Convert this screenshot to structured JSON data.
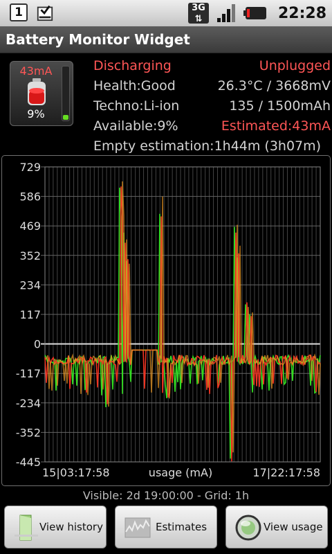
{
  "status_bar": {
    "notification_count": "1",
    "network_type": "3G",
    "time": "22:28"
  },
  "app": {
    "title": "Battery Monitor Widget"
  },
  "widget": {
    "current": "43mA",
    "percent": "9%",
    "level": 0.09
  },
  "info": {
    "state": "Discharging",
    "plug": "Unplugged",
    "health": "Health:Good",
    "temp_voltage": "26.3°C / 3668mV",
    "techno": "Techno:Li-ion",
    "capacity": "135 / 1500mAh",
    "available": "Available:9%",
    "estimated": "Estimated:43mA",
    "empty_estimation": "Empty estimation:1h44m (3h07m)"
  },
  "graph": {
    "y_ticks": [
      "729",
      "586",
      "469",
      "352",
      "234",
      "117",
      "0",
      "-117",
      "-234",
      "-352",
      "-445"
    ],
    "x_start_label": "15|03:17:58",
    "x_title": "usage (mA)",
    "x_end_label": "17|22:17:58",
    "colors": {
      "series_a": "#33dd22",
      "series_b": "#ee3322",
      "series_c": "#ee9922",
      "grid": "#444444",
      "zero": "#dddddd"
    }
  },
  "footer": {
    "visible_text": "Visible: 2d 19:00:00 - Grid: 1h"
  },
  "buttons": {
    "history": "View history",
    "estimates": "Estimates",
    "usage": "View usage"
  }
}
